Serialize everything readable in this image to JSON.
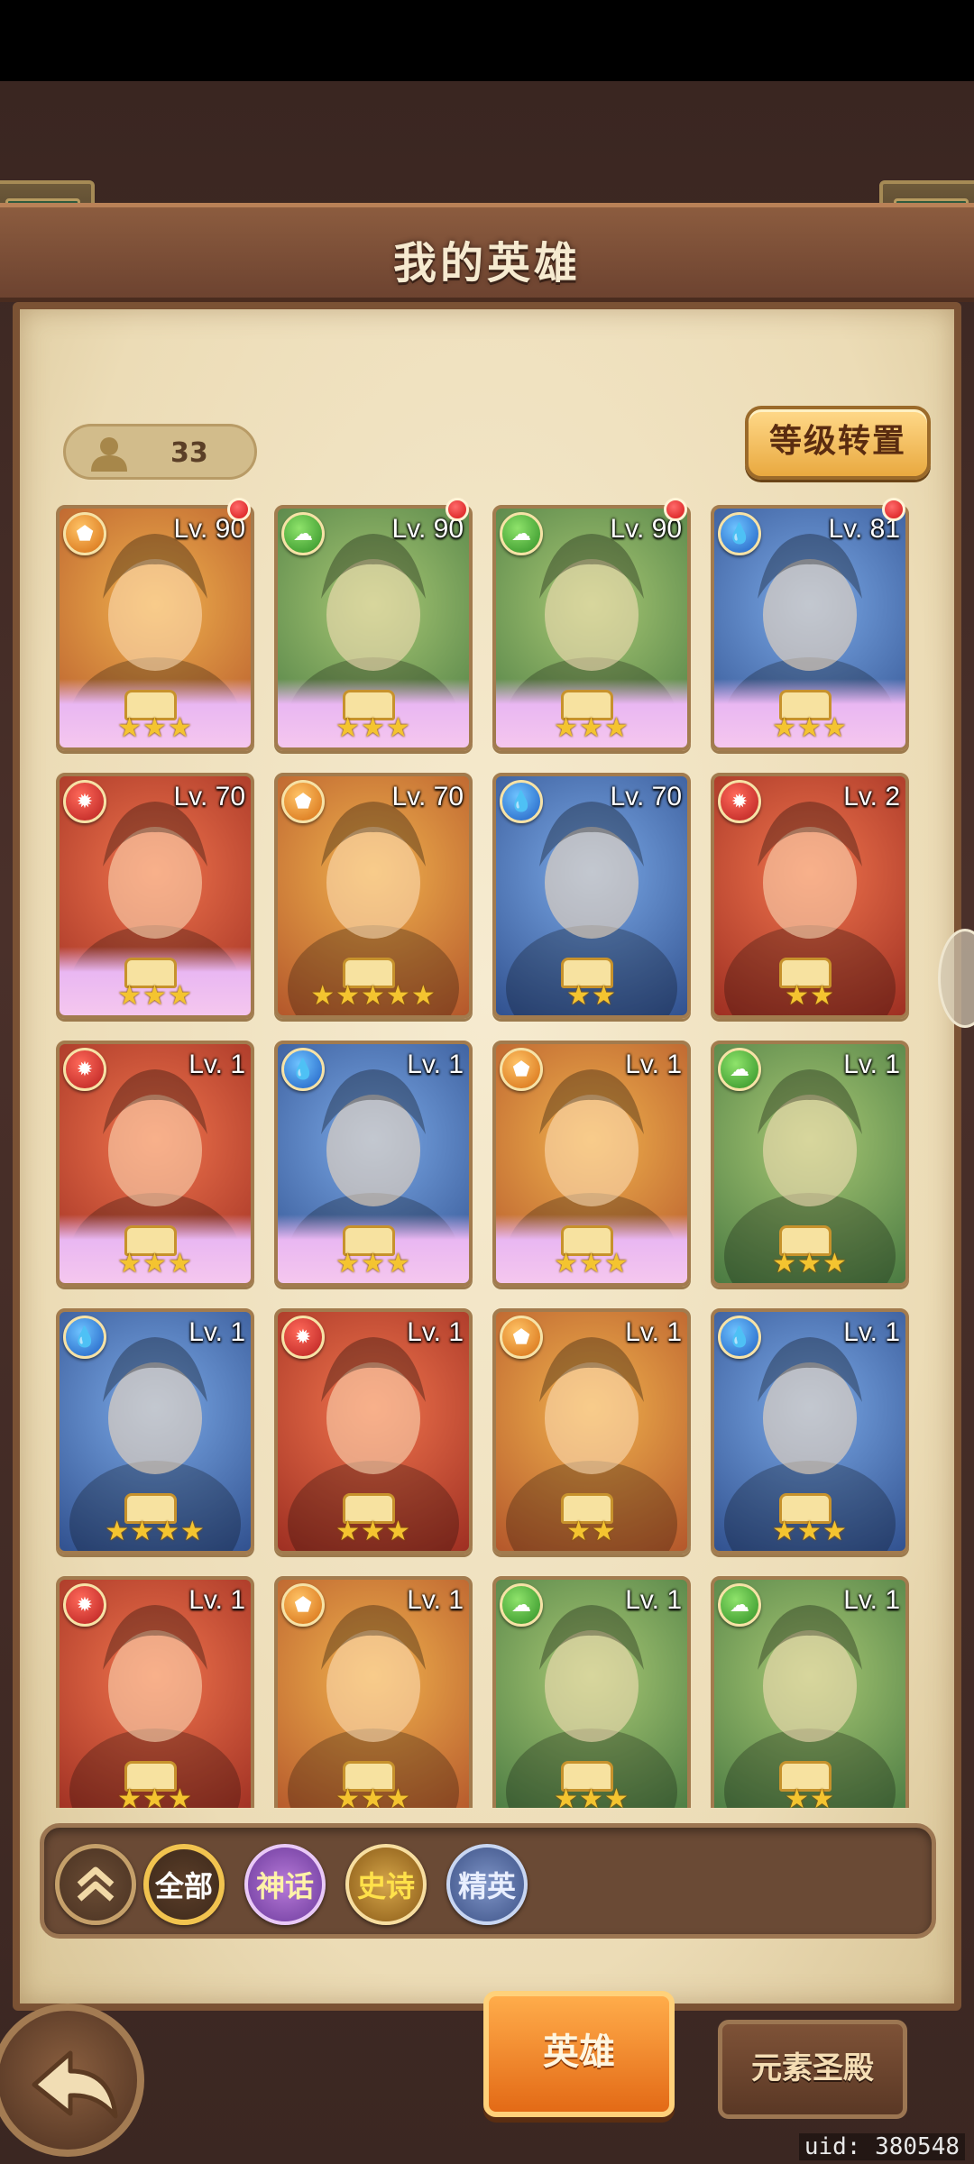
{
  "header": {
    "title": "我的英雄"
  },
  "hero_count": {
    "value": "33"
  },
  "buttons": {
    "level_transfer": "等级转置"
  },
  "heroes": [
    {
      "level": "Lv. 90",
      "element": "earth",
      "color": "orange",
      "rarity": "mythic",
      "stars": "★★★",
      "alert": true
    },
    {
      "level": "Lv. 90",
      "element": "wind",
      "color": "green",
      "rarity": "mythic",
      "stars": "★★★",
      "alert": true
    },
    {
      "level": "Lv. 90",
      "element": "wind",
      "color": "green",
      "rarity": "mythic",
      "stars": "★★★",
      "alert": true
    },
    {
      "level": "Lv. 81",
      "element": "water",
      "color": "blue",
      "rarity": "mythic",
      "stars": "★★★",
      "alert": true
    },
    {
      "level": "Lv. 70",
      "element": "fire",
      "color": "red",
      "rarity": "mythic",
      "stars": "★★★",
      "alert": false
    },
    {
      "level": "Lv. 70",
      "element": "earth",
      "color": "orange",
      "rarity": "epic",
      "stars": "★★★★★",
      "alert": false
    },
    {
      "level": "Lv. 70",
      "element": "water",
      "color": "blue",
      "rarity": "epic",
      "stars": "★★",
      "alert": false
    },
    {
      "level": "Lv. 2",
      "element": "fire",
      "color": "red",
      "rarity": "epic",
      "stars": "★★",
      "alert": false
    },
    {
      "level": "Lv. 1",
      "element": "fire",
      "color": "red",
      "rarity": "mythic",
      "stars": "★★★",
      "alert": false
    },
    {
      "level": "Lv. 1",
      "element": "water",
      "color": "blue",
      "rarity": "mythic",
      "stars": "★★★",
      "alert": false
    },
    {
      "level": "Lv. 1",
      "element": "earth",
      "color": "orange",
      "rarity": "mythic",
      "stars": "★★★",
      "alert": false
    },
    {
      "level": "Lv. 1",
      "element": "wind",
      "color": "green",
      "rarity": "epic",
      "stars": "★★★",
      "alert": false
    },
    {
      "level": "Lv. 1",
      "element": "water",
      "color": "blue",
      "rarity": "epic",
      "stars": "★★★★",
      "alert": false
    },
    {
      "level": "Lv. 1",
      "element": "fire",
      "color": "red",
      "rarity": "epic",
      "stars": "★★★",
      "alert": false
    },
    {
      "level": "Lv. 1",
      "element": "earth",
      "color": "orange",
      "rarity": "epic",
      "stars": "★★",
      "alert": false
    },
    {
      "level": "Lv. 1",
      "element": "water",
      "color": "blue",
      "rarity": "epic",
      "stars": "★★★",
      "alert": false
    },
    {
      "level": "Lv. 1",
      "element": "fire",
      "color": "red",
      "rarity": "epic",
      "stars": "★★★",
      "alert": false
    },
    {
      "level": "Lv. 1",
      "element": "earth",
      "color": "orange",
      "rarity": "epic",
      "stars": "★★★",
      "alert": false
    },
    {
      "level": "Lv. 1",
      "element": "wind",
      "color": "green",
      "rarity": "epic",
      "stars": "★★★",
      "alert": false
    },
    {
      "level": "Lv. 1",
      "element": "wind",
      "color": "green",
      "rarity": "epic",
      "stars": "★★",
      "alert": false
    }
  ],
  "filters": {
    "all": "全部",
    "mythic": "神话",
    "epic": "史诗",
    "elite": "精英"
  },
  "tabs": {
    "heroes": "英雄",
    "element_temple": "元素圣殿"
  },
  "footer": {
    "uid": "uid: 380548"
  },
  "colors": {
    "accent": "#e36a16",
    "alert": "#d41616",
    "gold": "#f4c430"
  }
}
